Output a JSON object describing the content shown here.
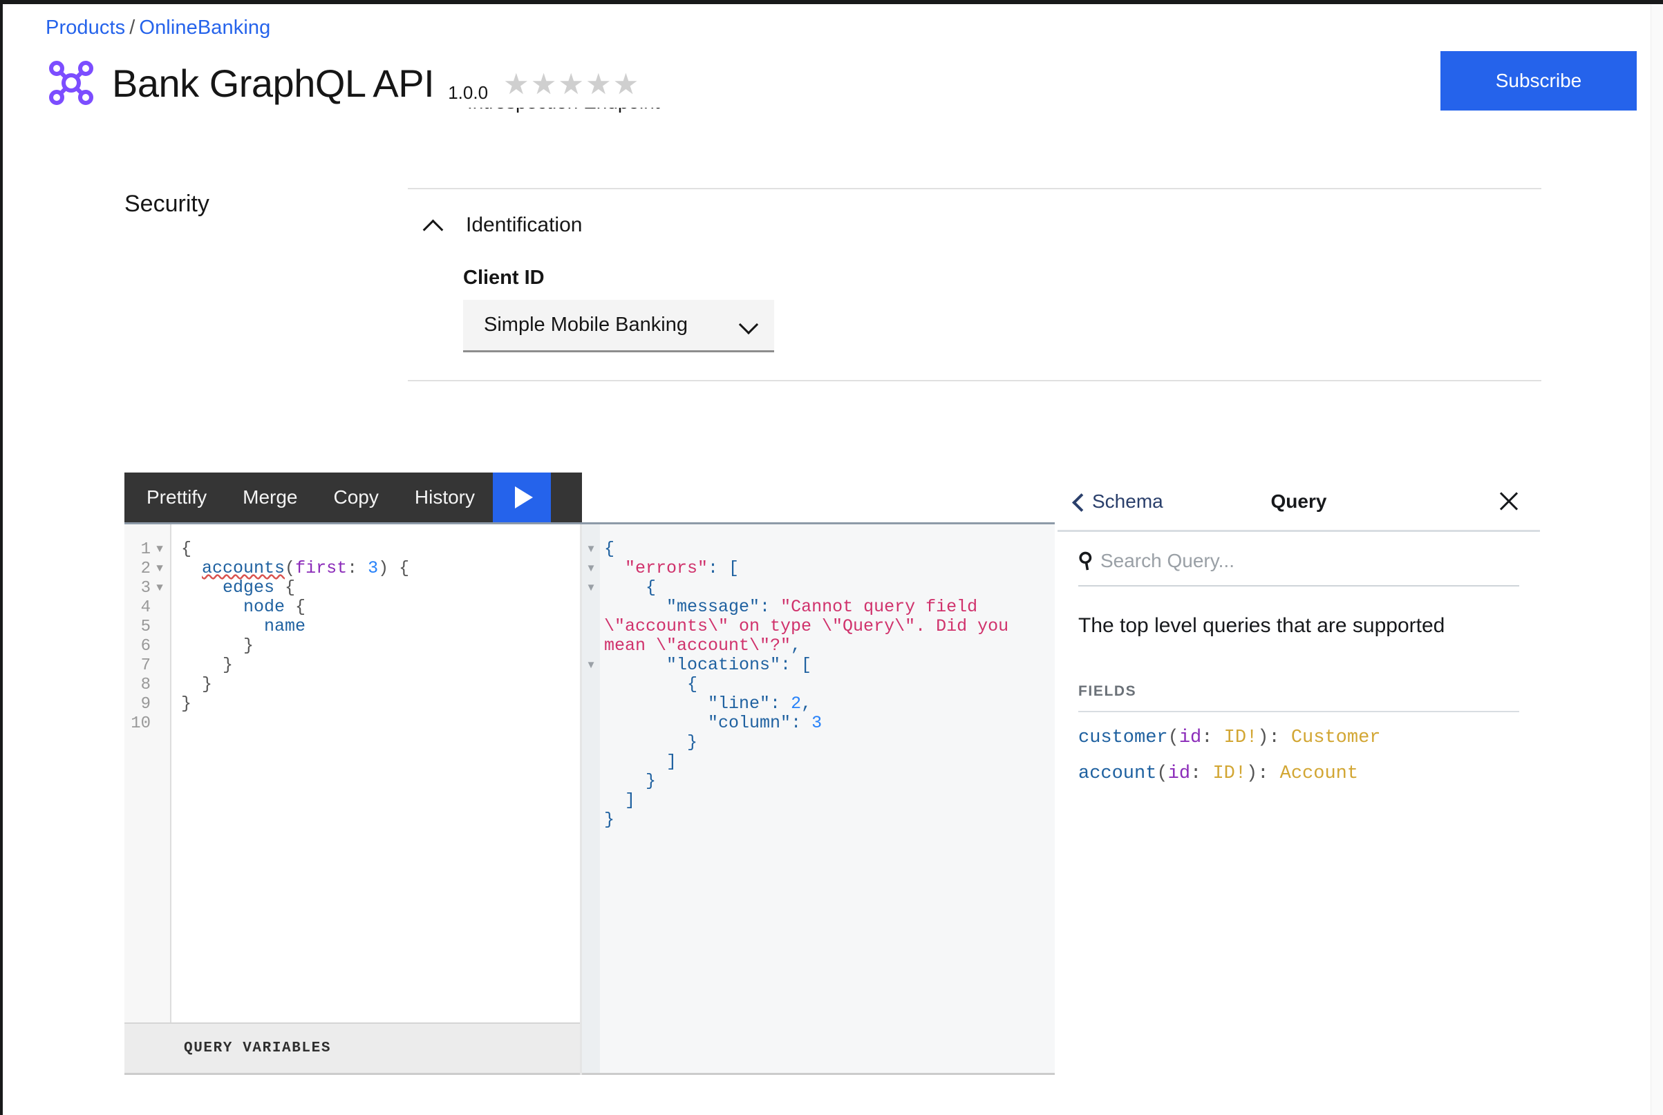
{
  "breadcrumb": {
    "root": "Products",
    "separator": "/",
    "current": "OnlineBanking"
  },
  "header": {
    "logo_icon": "graph-node-icon",
    "logo_color": "#7c4dff",
    "title": "Bank GraphQL API",
    "version": "1.0.0",
    "rating_stars": [
      "★",
      "★",
      "★",
      "★",
      "★"
    ],
    "rating_filled": 0,
    "subscribe_label": "Subscribe",
    "accent_color": "#2563eb"
  },
  "clipped_row": {
    "text": "Introspection Endpoint"
  },
  "security": {
    "section_label": "Security",
    "accordion": {
      "title": "Identification",
      "expanded": true,
      "chevron_icon": "chevron-up-icon"
    },
    "client_id": {
      "label": "Client ID",
      "selected": "Simple Mobile Banking",
      "chevron_icon": "chevron-down-icon"
    }
  },
  "graphiql": {
    "toolbar": {
      "buttons": [
        "Prettify",
        "Merge",
        "Copy",
        "History"
      ],
      "execute_icon": "play-icon",
      "execute_color": "#2563eb"
    },
    "query_editor": {
      "line_numbers": [
        "1",
        "2",
        "3",
        "4",
        "5",
        "6",
        "7",
        "8",
        "9",
        "10"
      ],
      "foldable_lines": [
        1,
        2,
        3
      ],
      "fold_icon": "triangle-down-icon",
      "lines": [
        {
          "indent": 0,
          "parts": [
            {
              "t": "{",
              "c": "tok-punct"
            }
          ]
        },
        {
          "indent": 1,
          "parts": [
            {
              "t": "accounts",
              "c": "tok-err"
            },
            {
              "t": "(",
              "c": "tok-punct"
            },
            {
              "t": "first",
              "c": "tok-arg"
            },
            {
              "t": ": ",
              "c": "tok-punct"
            },
            {
              "t": "3",
              "c": "tok-num"
            },
            {
              "t": ") {",
              "c": "tok-punct"
            }
          ]
        },
        {
          "indent": 2,
          "parts": [
            {
              "t": "edges",
              "c": "tok-field"
            },
            {
              "t": " {",
              "c": "tok-punct"
            }
          ]
        },
        {
          "indent": 3,
          "parts": [
            {
              "t": "node",
              "c": "tok-field"
            },
            {
              "t": " {",
              "c": "tok-punct"
            }
          ]
        },
        {
          "indent": 4,
          "parts": [
            {
              "t": "name",
              "c": "tok-field"
            }
          ]
        },
        {
          "indent": 3,
          "parts": [
            {
              "t": "}",
              "c": "tok-punct"
            }
          ]
        },
        {
          "indent": 2,
          "parts": [
            {
              "t": "}",
              "c": "tok-punct"
            }
          ]
        },
        {
          "indent": 1,
          "parts": [
            {
              "t": "}",
              "c": "tok-punct"
            }
          ]
        },
        {
          "indent": 0,
          "parts": [
            {
              "t": "}",
              "c": "tok-punct"
            }
          ]
        },
        {
          "indent": 0,
          "parts": []
        }
      ]
    },
    "variables_bar": {
      "label": "QUERY VARIABLES"
    },
    "result": {
      "fold_markers": [
        1,
        2,
        3,
        7
      ],
      "fold_icon": "triangle-down-icon",
      "lines": [
        {
          "indent": 0,
          "parts": [
            {
              "t": "{",
              "c": "r-key"
            }
          ]
        },
        {
          "indent": 1,
          "parts": [
            {
              "t": "\"errors\"",
              "c": "r-errkey"
            },
            {
              "t": ": [",
              "c": "r-key"
            }
          ]
        },
        {
          "indent": 2,
          "parts": [
            {
              "t": "{",
              "c": "r-key"
            }
          ]
        },
        {
          "indent": 3,
          "parts": [
            {
              "t": "\"message\"",
              "c": "r-key"
            },
            {
              "t": ": ",
              "c": "r-key"
            },
            {
              "t": "\"Cannot query field \\\"accounts\\\" on type \\\"Query\\\". Did you mean \\\"account\\\"?\"",
              "c": "r-str"
            },
            {
              "t": ",",
              "c": "r-key"
            }
          ]
        },
        {
          "indent": 3,
          "parts": [
            {
              "t": "\"locations\"",
              "c": "r-key"
            },
            {
              "t": ": [",
              "c": "r-key"
            }
          ]
        },
        {
          "indent": 4,
          "parts": [
            {
              "t": "{",
              "c": "r-key"
            }
          ]
        },
        {
          "indent": 5,
          "parts": [
            {
              "t": "\"line\"",
              "c": "r-key"
            },
            {
              "t": ": ",
              "c": "r-key"
            },
            {
              "t": "2",
              "c": "r-num"
            },
            {
              "t": ",",
              "c": "r-key"
            }
          ]
        },
        {
          "indent": 5,
          "parts": [
            {
              "t": "\"column\"",
              "c": "r-key"
            },
            {
              "t": ": ",
              "c": "r-key"
            },
            {
              "t": "3",
              "c": "r-num"
            }
          ]
        },
        {
          "indent": 4,
          "parts": [
            {
              "t": "}",
              "c": "r-key"
            }
          ]
        },
        {
          "indent": 3,
          "parts": [
            {
              "t": "]",
              "c": "r-key"
            }
          ]
        },
        {
          "indent": 2,
          "parts": [
            {
              "t": "}",
              "c": "r-key"
            }
          ]
        },
        {
          "indent": 1,
          "parts": [
            {
              "t": "]",
              "c": "r-key"
            }
          ]
        },
        {
          "indent": 0,
          "parts": [
            {
              "t": "}",
              "c": "r-key"
            }
          ]
        }
      ]
    }
  },
  "doc_explorer": {
    "back_label": "Schema",
    "back_icon": "chevron-left-icon",
    "title": "Query",
    "close_icon": "close-icon",
    "search_icon": "search-icon",
    "search_placeholder": "Search Query...",
    "search_value": "",
    "description": "The top level queries that are supported",
    "fields_heading": "FIELDS",
    "fields": [
      {
        "name": "customer",
        "arg_name": "id",
        "arg_type": "ID!",
        "return_type": "Customer"
      },
      {
        "name": "account",
        "arg_name": "id",
        "arg_type": "ID!",
        "return_type": "Account"
      }
    ]
  }
}
